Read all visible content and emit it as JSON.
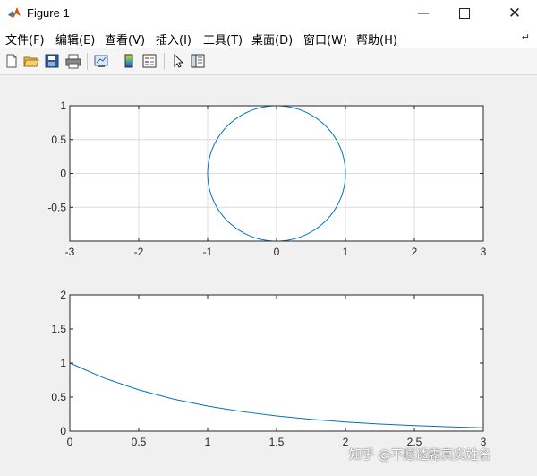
{
  "window": {
    "title": "Figure 1",
    "controls": [
      "minimize",
      "maximize",
      "close"
    ]
  },
  "menubar": {
    "items": [
      {
        "label": "文件(F)"
      },
      {
        "label": "编辑(E)"
      },
      {
        "label": "查看(V)"
      },
      {
        "label": "插入(I)"
      },
      {
        "label": "工具(T)"
      },
      {
        "label": "桌面(D)"
      },
      {
        "label": "窗口(W)"
      },
      {
        "label": "帮助(H)"
      }
    ]
  },
  "toolbar": {
    "icons": [
      "new-figure-icon",
      "open-file-icon",
      "save-icon",
      "print-icon",
      "link-plot-icon",
      "insert-colorbar-icon",
      "insert-legend-icon",
      "edit-plot-arrow-icon",
      "plot-tools-icon"
    ]
  },
  "colors": {
    "line": "#0072bd",
    "axes_bg": "#ffffff",
    "figure_bg": "#f0f0f0",
    "grid": "#dcdcdc"
  },
  "chart_data": [
    {
      "type": "line",
      "title": "",
      "xlabel": "",
      "ylabel": "",
      "grid": true,
      "xlim": [
        -3,
        3
      ],
      "ylim": [
        -1,
        1
      ],
      "xticks": [
        "-3",
        "-2",
        "-1",
        "0",
        "1",
        "2",
        "3"
      ],
      "yticks": [
        "1",
        "0.5",
        "0",
        "-0.5"
      ],
      "series": [
        {
          "curve": "circle",
          "center": [
            0,
            0
          ],
          "radius": 1
        }
      ]
    },
    {
      "type": "line",
      "title": "",
      "xlabel": "",
      "ylabel": "",
      "grid": false,
      "xlim": [
        0,
        3
      ],
      "ylim": [
        0,
        2
      ],
      "xticks": [
        "0",
        "0.5",
        "1",
        "1.5",
        "2",
        "2.5",
        "3"
      ],
      "yticks": [
        "2",
        "1.5",
        "1",
        "0.5",
        "0"
      ],
      "series": [
        {
          "x": [
            0,
            0.25,
            0.5,
            0.75,
            1,
            1.25,
            1.5,
            1.75,
            2,
            2.25,
            2.5,
            2.75,
            3
          ],
          "y": [
            1.0,
            0.779,
            0.607,
            0.472,
            0.368,
            0.287,
            0.223,
            0.174,
            0.135,
            0.105,
            0.082,
            0.064,
            0.05
          ]
        }
      ]
    }
  ],
  "watermark": "知乎 @不愿透露真实姓名"
}
